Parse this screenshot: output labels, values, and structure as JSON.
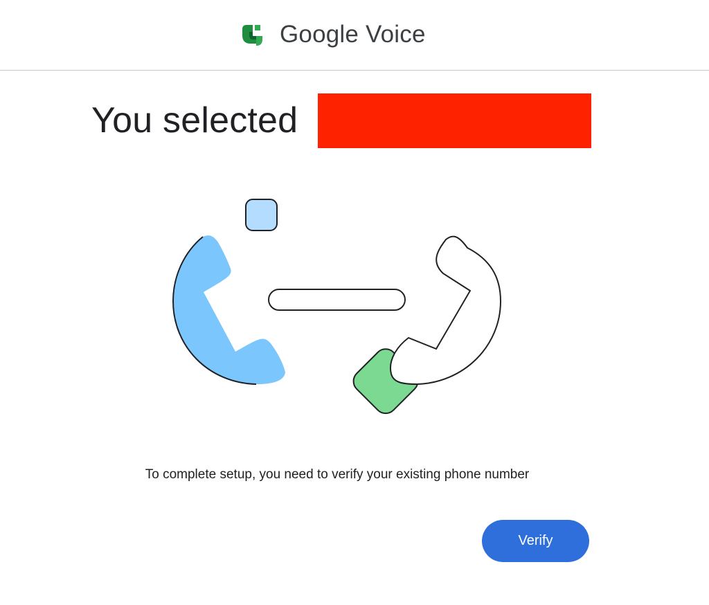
{
  "header": {
    "app_name": "Google Voice",
    "logo_icon": "google-voice-logo-icon"
  },
  "main": {
    "title": "You selected",
    "redacted_value_note": "",
    "message": "To complete setup, you need to verify your existing phone number",
    "verify_label": "Verify"
  },
  "illustration": {
    "icons": [
      "phone-handset-left-icon",
      "phone-handset-right-icon",
      "connection-bar",
      "square-accent-blue",
      "square-accent-green"
    ]
  },
  "colors": {
    "accent_blue": "#2f6fdb",
    "handset_blue": "#7cc6fe",
    "square_light_blue": "#b3dcff",
    "square_green": "#7cd992",
    "logo_green_dark": "#1e8e3e",
    "logo_green_light": "#34a853",
    "redaction": "#ff2200"
  }
}
